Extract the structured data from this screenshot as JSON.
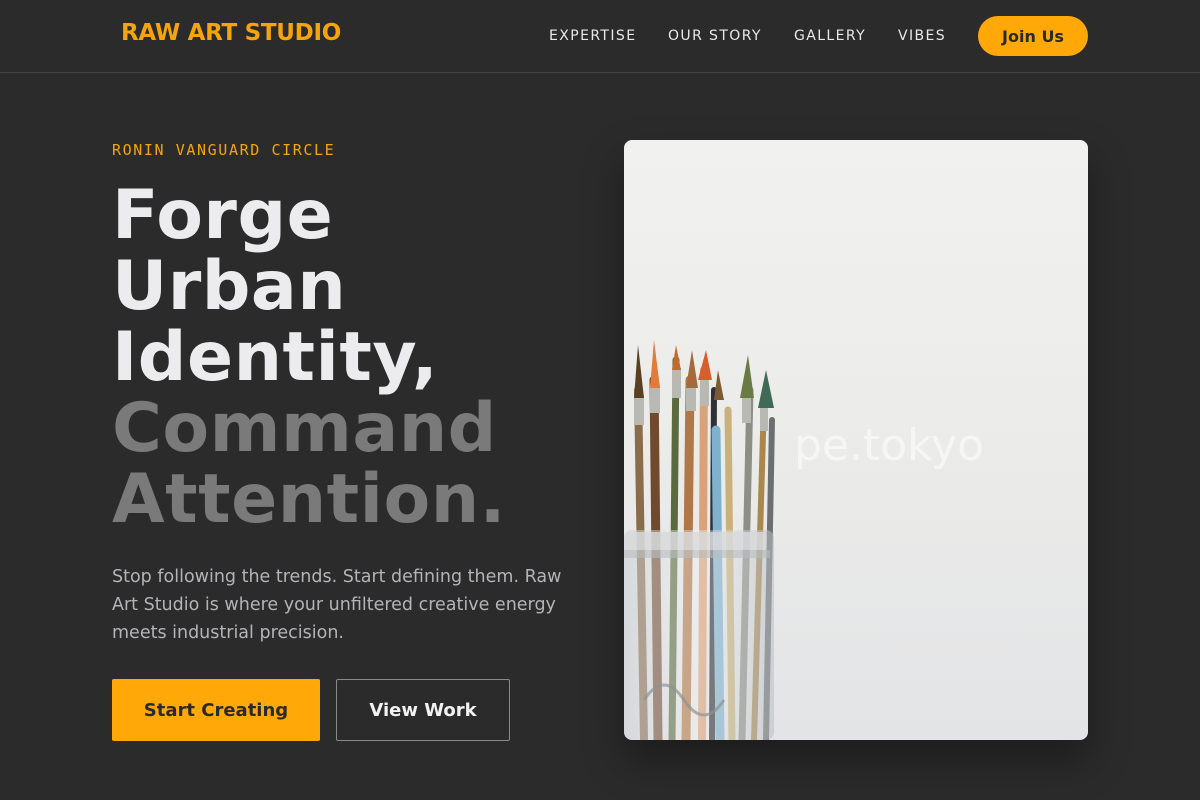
{
  "header": {
    "logo": "RAW ART STUDIO",
    "nav": [
      {
        "label": "EXPERTISE",
        "name": "nav-expertise"
      },
      {
        "label": "OUR STORY",
        "name": "nav-our-story"
      },
      {
        "label": "GALLERY",
        "name": "nav-gallery"
      },
      {
        "label": "VIBES",
        "name": "nav-vibes"
      }
    ],
    "cta": "Join Us"
  },
  "hero": {
    "eyebrow": "RONIN VANGUARD CIRCLE",
    "headline_lines": [
      {
        "text": "Forge",
        "tone": "light"
      },
      {
        "text": "Urban",
        "tone": "light"
      },
      {
        "text": "Identity,",
        "tone": "light"
      },
      {
        "text": "Command",
        "tone": "dim"
      },
      {
        "text": "Attention.",
        "tone": "dim"
      }
    ],
    "lead": "Stop following the trends. Start defining them. Raw Art Studio is where your unfiltered creative energy meets industrial precision.",
    "primary_cta": "Start Creating",
    "secondary_cta": "View Work",
    "image": {
      "subject": "paintbrushes in a glass jar",
      "watermark": "pe.tokyo"
    }
  },
  "colors": {
    "background": "#2b2b2b",
    "accent": "#ffa807",
    "headline_light": "#ececee",
    "headline_dim": "#7a7a7a",
    "body_text": "#b4b4b8"
  }
}
